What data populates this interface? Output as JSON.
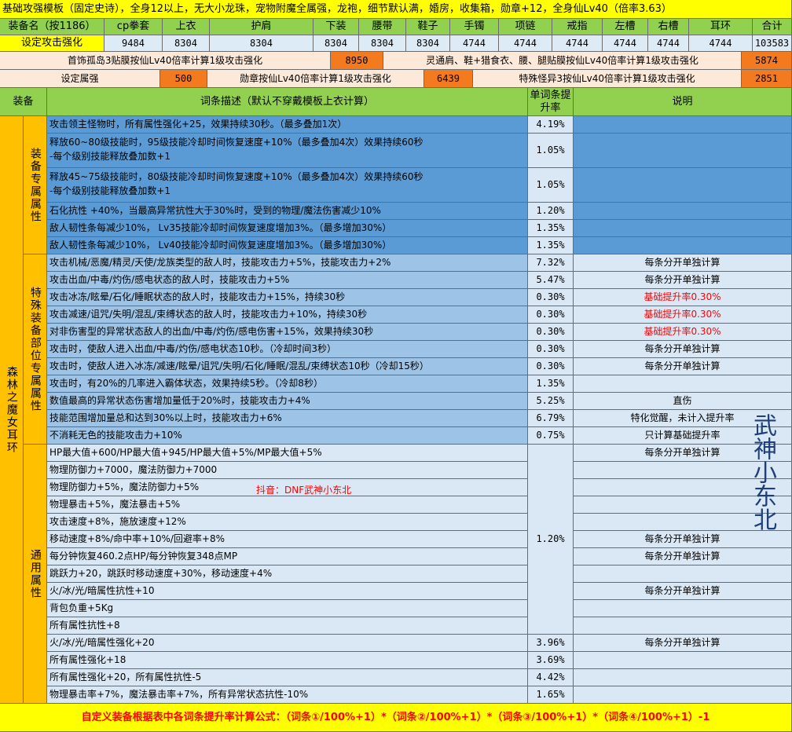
{
  "title": "基础攻强模板（固定史诗），全身12以上，无大小龙珠，宠物附魔全属强，龙袍，细节默认满，婚房，收集箱，勋章+12，全身仙Lv40（倍率3.63）",
  "header": {
    "cols": [
      "装备名（按1186）",
      "cp拳套",
      "上衣",
      "护肩",
      "下装",
      "腰带",
      "鞋子",
      "手镯",
      "项链",
      "戒指",
      "左槽",
      "右槽",
      "耳环",
      "合计"
    ],
    "row_label": "设定攻击强化",
    "row_values": [
      "9484",
      "8304",
      "8304",
      "8304",
      "8304",
      "8304",
      "4744",
      "4744",
      "4744",
      "4744",
      "4744",
      "4744",
      "103583"
    ]
  },
  "info": {
    "r1_a_label": "首饰孤岛3贴膜按仙Lv40倍率计算1级攻击强化",
    "r1_a_value": "8950",
    "r1_b_label": "灵通肩、鞋+猎食衣、腰、腿贴膜按仙Lv40倍率计算1级攻击强化",
    "r1_b_value": "5874",
    "r2_a_label": "设定属强",
    "r2_a_value": "500",
    "r2_b_label": "勋章按仙Lv40倍率计算1级攻击强化",
    "r2_b_value": "6439",
    "r2_c_label": "特殊怪异3按仙Lv40倍率计算1级攻击强化",
    "r2_c_value": "2851"
  },
  "table_header": {
    "equip": "装备",
    "desc": "词条描述（默认不穿戴模板上衣计算）",
    "rate": "单词条提升率",
    "note": "说明"
  },
  "item_name": "森林之魔女耳环",
  "groups": [
    {
      "name": "装备专属属性"
    },
    {
      "name": "特殊装备部位专属属性"
    },
    {
      "name": "通用属性"
    }
  ],
  "rows_blue": [
    {
      "desc": "攻击领主怪物时，所有属性强化+25，效果持续30秒。（最多叠加1次）",
      "rate": "4.19%",
      "note": ""
    },
    {
      "desc": "释放60~80级技能时，95级技能冷却时间恢复速度+10%（最多叠加4次）效果持续60秒\n-每个级别技能释放叠加数+1",
      "rate": "1.05%",
      "note": ""
    },
    {
      "desc": "释放45~75级技能时，80级技能冷却时间恢复速度+10%（最多叠加4次）效果持续60秒\n-每个级别技能释放叠加数+1",
      "rate": "1.05%",
      "note": ""
    },
    {
      "desc": "石化抗性 +40%，当最高异常抗性大于30%时，受到的物理/魔法伤害减少10%",
      "rate": "1.20%",
      "note": ""
    },
    {
      "desc": "敌人韧性条每减少10%， Lv35技能冷却时间恢复速度增加3%。（最多增加30%）",
      "rate": "1.35%",
      "note": ""
    },
    {
      "desc": "敌人韧性条每减少10%， Lv40技能冷却时间恢复速度增加3%。（最多增加30%）",
      "rate": "1.35%",
      "note": ""
    }
  ],
  "rows_special": [
    {
      "desc": "攻击机械/恶魔/精灵/天使/龙族类型的敌人时，技能攻击力+5%，技能攻击力+2%",
      "rate": "7.32%",
      "note": "每条分开单独计算",
      "red": false
    },
    {
      "desc": "攻击出血/中毒/灼伤/感电状态的敌人时，技能攻击力+5%",
      "rate": "5.47%",
      "note": "每条分开单独计算",
      "red": false
    },
    {
      "desc": "攻击冰冻/眩晕/石化/睡眠状态的敌人时，技能攻击力+15%，持续30秒",
      "rate": "0.30%",
      "note": "基础提升率0.30%",
      "red": true
    },
    {
      "desc": "攻击减速/诅咒/失明/混乱/束缚状态的敌人时，技能攻击力+10%，持续30秒",
      "rate": "0.30%",
      "note": "基础提升率0.30%",
      "red": true
    },
    {
      "desc": "对非伤害型的异常状态敌人的出血/中毒/灼伤/感电伤害+15%，效果持续30秒",
      "rate": "0.30%",
      "note": "基础提升率0.30%",
      "red": true
    },
    {
      "desc": "攻击时，使敌人进入出血/中毒/灼伤/感电状态10秒。（冷却时间3秒）",
      "rate": "0.30%",
      "note": "每条分开单独计算",
      "red": false
    },
    {
      "desc": "攻击时，使敌人进入冰冻/减速/眩晕/诅咒/失明/石化/睡眠/混乱/束缚状态10秒（冷却15秒）",
      "rate": "0.30%",
      "note": "每条分开单独计算",
      "red": false
    },
    {
      "desc": "攻击时，有20%的几率进入霸体状态，效果持续5秒。（冷却8秒）",
      "rate": "1.35%",
      "note": "",
      "red": false
    },
    {
      "desc": "数值最高的异常状态伤害增加量低于20%时，技能攻击力+4%",
      "rate": "5.25%",
      "note": "直伤",
      "red": false
    },
    {
      "desc": "技能范围增加量总和达到30%以上时，技能攻击力+6%",
      "rate": "6.79%",
      "note": "特化觉醒，未计入提升率",
      "red": false
    },
    {
      "desc": "不消耗无色的技能攻击力+10%",
      "rate": "0.75%",
      "note": "只计算基础提升率",
      "red": false
    }
  ],
  "rows_common": [
    {
      "desc": "HP最大值+600/HP最大值+945/HP最大值+5%/MP最大值+5%",
      "note": "每条分开单独计算"
    },
    {
      "desc": "物理防御力+7000，魔法防御力+7000",
      "note": ""
    },
    {
      "desc": "物理防御力+5%，魔法防御力+5%",
      "note": ""
    },
    {
      "desc": "物理暴击+5%，魔法暴击+5%",
      "note": ""
    },
    {
      "desc": "攻击速度+8%，施放速度+12%",
      "note": ""
    },
    {
      "desc": "移动速度+8%/命中率+10%/回避率+8%",
      "note": "每条分开单独计算"
    },
    {
      "desc": "每分钟恢复460.2点HP/每分钟恢复348点MP",
      "note": "每条分开单独计算"
    },
    {
      "desc": "跳跃力+20，跳跃时移动速度+30%，移动速度+4%",
      "note": ""
    },
    {
      "desc": "火/冰/光/暗属性抗性+10",
      "note": "每条分开单独计算"
    },
    {
      "desc": "背包负重+5Kg",
      "note": ""
    },
    {
      "desc": "所有属性抗性+8",
      "note": ""
    }
  ],
  "common_rate": "1.20%",
  "rows_common_tail": [
    {
      "desc": "火/冰/光/暗属性强化+20",
      "rate": "3.96%",
      "note": "每条分开单独计算"
    },
    {
      "desc": "所有属性强化+18",
      "rate": "3.69%",
      "note": ""
    },
    {
      "desc": "所有属性强化+20，所有属性抗性-5",
      "rate": "4.42%",
      "note": ""
    },
    {
      "desc": "物理暴击率+7%，魔法暴击率+7%，所有异常状态抗性-10%",
      "rate": "1.65%",
      "note": ""
    }
  ],
  "watermark_red": "抖音：DNF武神小东北",
  "watermark_vertical": "武神小东北",
  "footer": "自定义装备根据表中各词条提升率计算公式：（词条①/100%+1）*（词条②/100%+1）*（词条③/100%+1）*（词条④/100%+1）-1"
}
